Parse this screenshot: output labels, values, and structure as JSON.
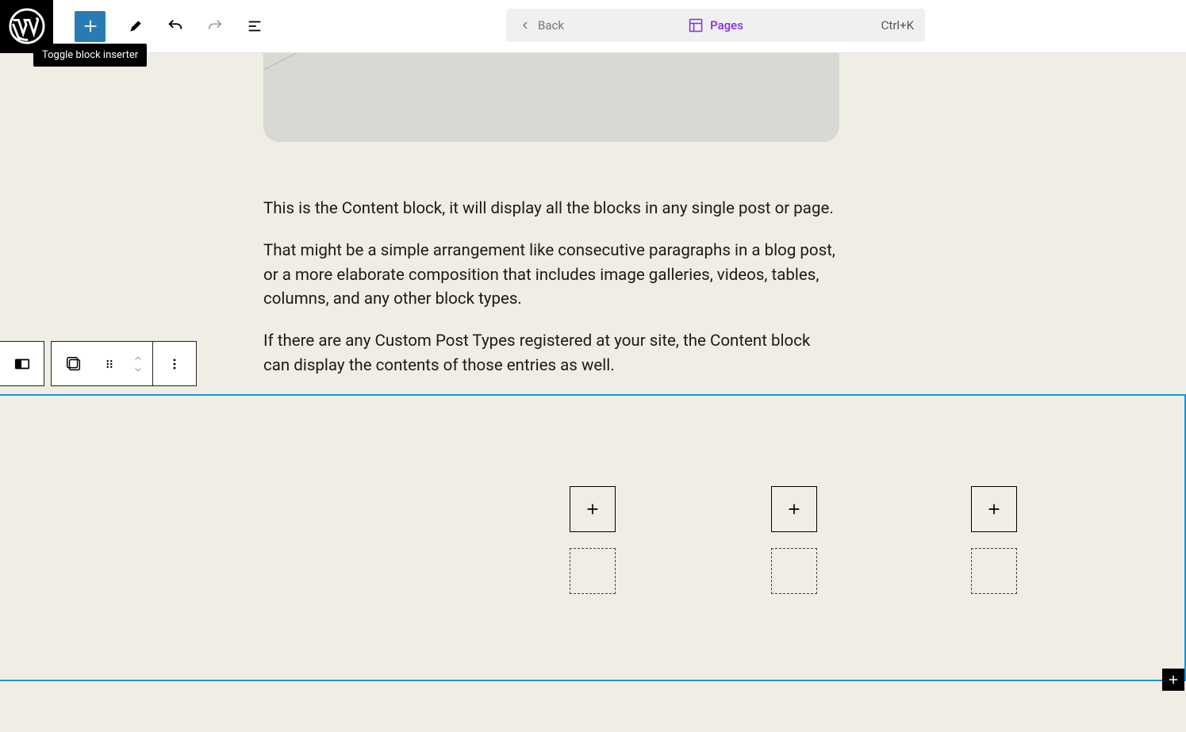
{
  "topbar": {
    "back_label": "Back",
    "center_label": "Pages",
    "shortcut": "Ctrl+K",
    "tooltip": "Toggle block inserter"
  },
  "content": {
    "p1": "This is the Content block, it will display all the blocks in any single post or page.",
    "p2": "That might be a simple arrangement like consecutive paragraphs in a blog post, or a more elaborate composition that includes image galleries, videos, tables, columns, and any other block types.",
    "p3": "If there are any Custom Post Types registered at your site, the Content block can display the contents of those entries as well."
  }
}
